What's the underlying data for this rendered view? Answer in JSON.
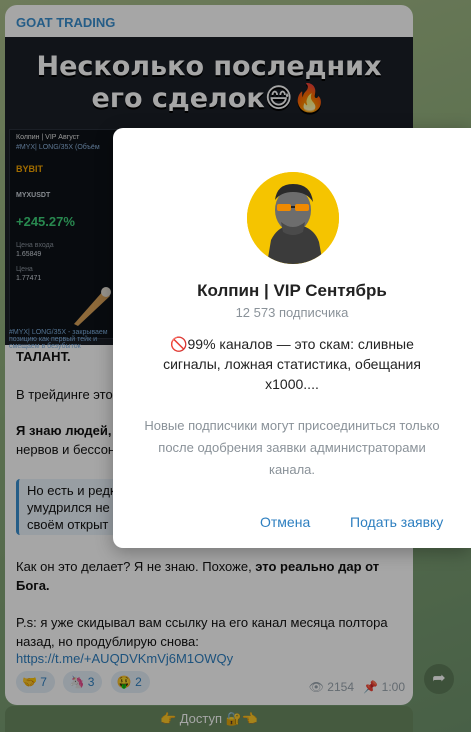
{
  "post": {
    "channel_name": "GOAT TRADING",
    "image_title_line1": "Несколько последних",
    "image_title_line2": "его сделок😅🔥",
    "screenshot": {
      "header": "Колпин | VIP Август",
      "tag": "#MYX| LONG/35X (Объём",
      "exchange": "BYBIT",
      "pair": "MYXUSDT",
      "pnl": "+245.27%",
      "entry_label": "Цена входа",
      "entry_value": "1.65849",
      "last_label": "Цена",
      "last_value": "1.77471",
      "caption": "#MYX| LONG/35X - закрываем позицию как первый тейк и смещаем в безубыток"
    },
    "p1_bold": "ТАЛАНТ.",
    "p2": "В трейдинге это",
    "p3_bold": "Я знаю людей,",
    "p3_rest": "нервов и бессон",
    "quote_line1": "Но есть и редк",
    "quote_line2": "умудрился не",
    "quote_line3": "своём открыт",
    "p4_normal": "Как он это делает? Я не знаю. Похоже, ",
    "p4_bold": "это реально дар от Бога.",
    "p5": "P.s: я уже скидывал вам ссылку на его канал месяца полтора назад, но продублирую снова:",
    "link": "https://t.me/+AUQDVKmVj6M1OWQy",
    "reactions": [
      {
        "emoji": "🤝",
        "count": "7"
      },
      {
        "emoji": "🦄",
        "count": "3"
      },
      {
        "emoji": "🤑",
        "count": "2"
      }
    ],
    "views": "2154",
    "time": "1:00",
    "access_button": "👉 Доступ 🔐👈"
  },
  "dialog": {
    "title": "Колпин | VIP Сентябрь",
    "subscribers": "12 573 подписчика",
    "description": "🚫99% каналов — это скам: сливные сигналы, ложная статистика, обещания х1000....",
    "note": "Новые подписчики могут присоединиться только после одобрения заявки администраторами канала.",
    "cancel_label": "Отмена",
    "apply_label": "Подать заявку"
  },
  "colors": {
    "accent": "#2d7fc0",
    "avatar_bg": "#f5c400"
  }
}
